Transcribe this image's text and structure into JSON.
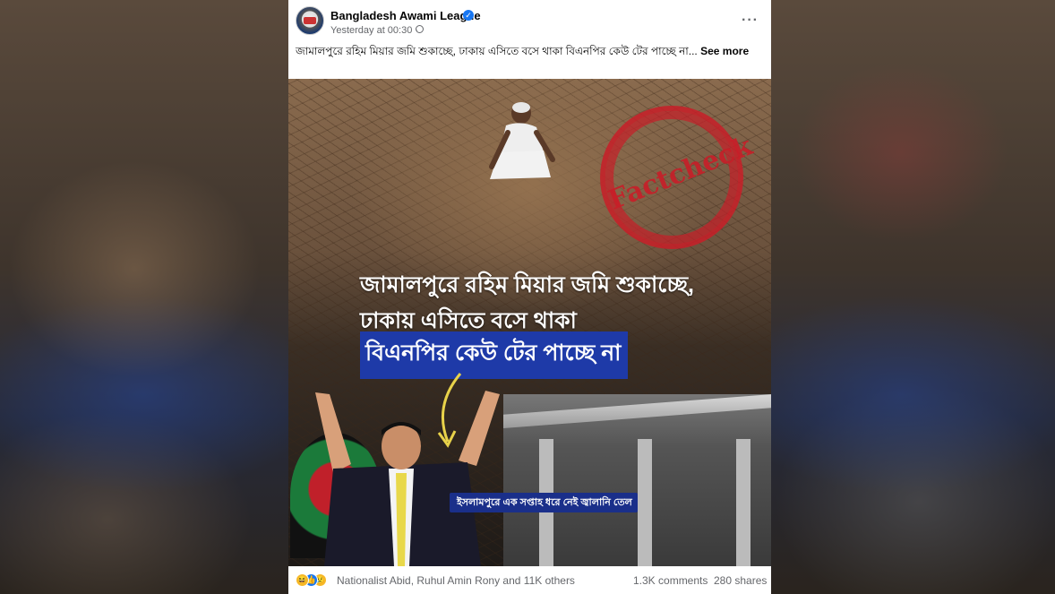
{
  "post": {
    "page_name": "Bangladesh Awami League",
    "time": "Yesterday at 00:30",
    "dot": "·",
    "more_menu": "···",
    "caption": "জামালপুরে রহিম মিয়ার জমি শুকাচ্ছে, ঢাকায় এসিতে বসে থাকা বিএনপির কেউ টের পাচ্ছে না...",
    "see_more": "See more"
  },
  "image": {
    "stamp_text": "Factcheck",
    "headline_line1": "জামালপুরে রহিম মিয়ার জমি শুকাচ্ছে,",
    "headline_line2": "ঢাকায় এসিতে বসে থাকা",
    "headline_line3": "বিএনপির কেউ টের পাচ্ছে না",
    "news_strip": "ইসলামপুরে এক সপ্তাহ ধরে নেই জ্বালানি তেল"
  },
  "footer": {
    "reactors": "Nationalist Abid, Ruhul Amin Rony and 11K others",
    "comments": "1.3K comments",
    "shares": "280 shares"
  },
  "icons": {
    "verified": "verified-badge-icon",
    "globe": "globe-icon",
    "reactions": [
      "haha-icon",
      "like-icon",
      "sad-icon"
    ]
  },
  "colors": {
    "verified_blue": "#1877f2",
    "stamp_red": "#c81e28",
    "headline_highlight": "#1e3aa8"
  }
}
